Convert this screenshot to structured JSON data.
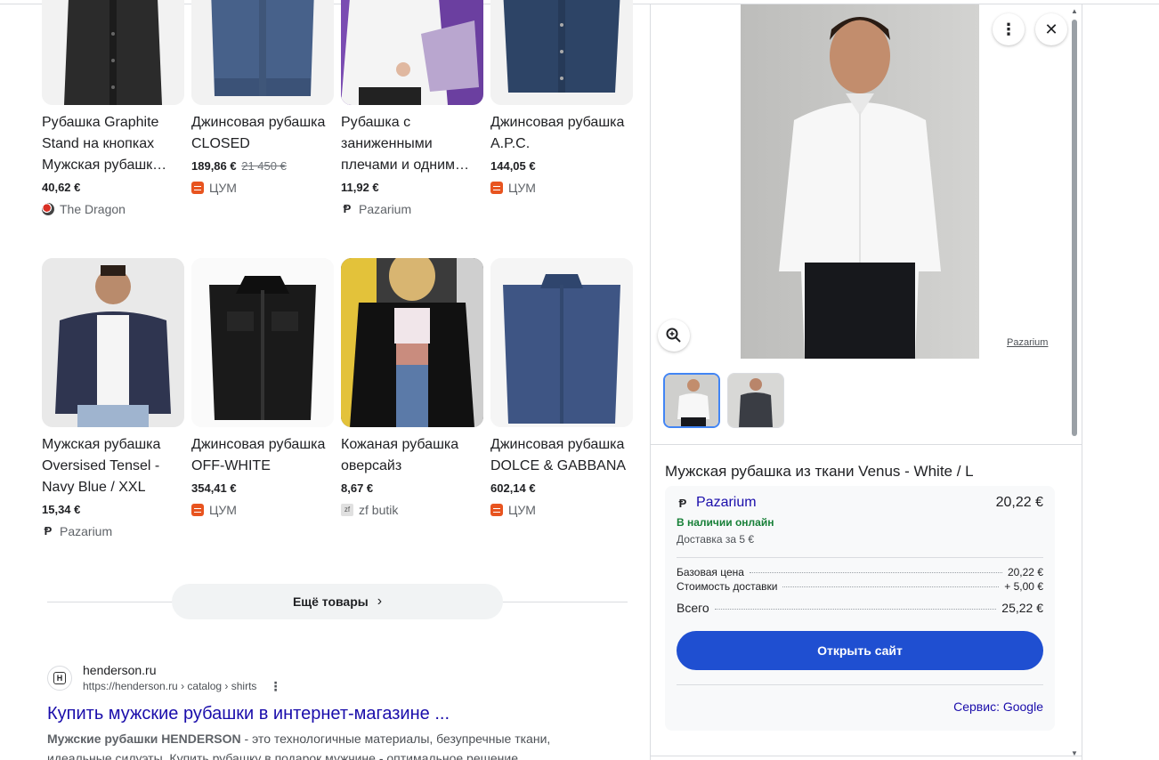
{
  "products": [
    {
      "title": "Рубашка Graphite Stand на кнопках Мужская рубашк…",
      "price": "40,62 €",
      "old_price": "",
      "seller": "The Dragon",
      "seller_icon": "dragon-logo-icon",
      "image": "black-shirt"
    },
    {
      "title": "Джинсовая рубашка CLOSED",
      "price": "189,86 €",
      "old_price": "21 450 €",
      "seller": "ЦУМ",
      "seller_icon": "tsum-logo-icon",
      "image": "denim-light"
    },
    {
      "title": "Рубашка с заниженными плечами и одним…",
      "price": "11,92 €",
      "old_price": "",
      "seller": "Pazarium",
      "seller_icon": "pazarium-logo-icon",
      "image": "white-shirt-purple"
    },
    {
      "title": "Джинсовая рубашка A.P.C.",
      "price": "144,05 €",
      "old_price": "",
      "seller": "ЦУМ",
      "seller_icon": "tsum-logo-icon",
      "image": "denim-dark"
    },
    {
      "title": "Мужская рубашка Oversised Tensel - Navy Blue / XXL",
      "price": "15,34 €",
      "old_price": "",
      "seller": "Pazarium",
      "seller_icon": "pazarium-logo-icon",
      "image": "navy-man"
    },
    {
      "title": "Джинсовая рубашка OFF-WHITE",
      "price": "354,41 €",
      "old_price": "",
      "seller": "ЦУМ",
      "seller_icon": "tsum-logo-icon",
      "image": "black-denim"
    },
    {
      "title": "Кожаная рубашка оверсайз",
      "price": "8,67 €",
      "old_price": "",
      "seller": "zf butik",
      "seller_icon": "zf-butik-logo-icon",
      "image": "leather-woman"
    },
    {
      "title": "Джинсовая рубашка DOLCE & GABBANA",
      "price": "602,14 €",
      "old_price": "",
      "seller": "ЦУМ",
      "seller_icon": "tsum-logo-icon",
      "image": "blue-denim"
    }
  ],
  "more_button": {
    "label": "Ещё товары",
    "icon": "chevron-right-icon"
  },
  "result": {
    "site": "henderson.ru",
    "url": "https://henderson.ru › catalog › shirts",
    "favicon_letter": "H",
    "title": "Купить мужские рубашки в интернет-магазине ...",
    "snippet_bold": "Мужские рубашки HENDERSON",
    "snippet_line1": " - это технологичные материалы, безупречные ткани,",
    "snippet_line2": "идеальные силуэты. Купить рубашку в подарок мужчине - оптимальное решение, ..."
  },
  "panel": {
    "source_label": "Pazarium",
    "product_title": "Мужская рубашка из ткани Venus - White / L",
    "seller": "Pazarium",
    "price": "20,22 €",
    "availability": "В наличии онлайн",
    "shipping": "Доставка за 5 €",
    "rows": [
      {
        "label": "Базовая цена",
        "value": "20,22 €"
      },
      {
        "label": "Стоимость доставки",
        "value": "+ 5,00 €"
      }
    ],
    "total_label": "Всего",
    "total_value": "25,22 €",
    "open_button": "Открыть сайт",
    "service": "Сервис: Google"
  },
  "colors": {
    "link": "#1a0dab",
    "accent_button": "#1f4fd1",
    "in_stock": "#188038",
    "tsum": "#e8541f"
  }
}
